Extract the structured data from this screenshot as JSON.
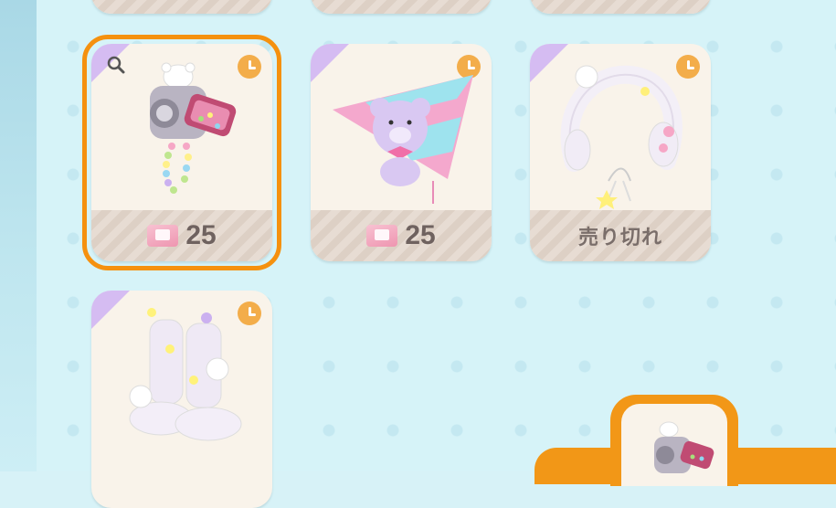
{
  "shop": {
    "items": [
      {
        "price": "25",
        "state": "selected",
        "icon": "camera-charm"
      },
      {
        "price": "25",
        "state": "normal",
        "icon": "bear-kite"
      },
      {
        "price_label": "売り切れ",
        "state": "soldout",
        "icon": "fluffy-earmuffs"
      },
      {
        "price": "",
        "state": "normal",
        "icon": "bear-boots"
      }
    ],
    "currency_icon": "ticket-envelope-icon",
    "timer_icon": "clock-icon",
    "colors": {
      "accent": "#f5910f",
      "card": "#f9f3ea",
      "timer": "#f3ad4a",
      "corner": "#d5bcf2",
      "background": "#d6f3f8"
    }
  }
}
